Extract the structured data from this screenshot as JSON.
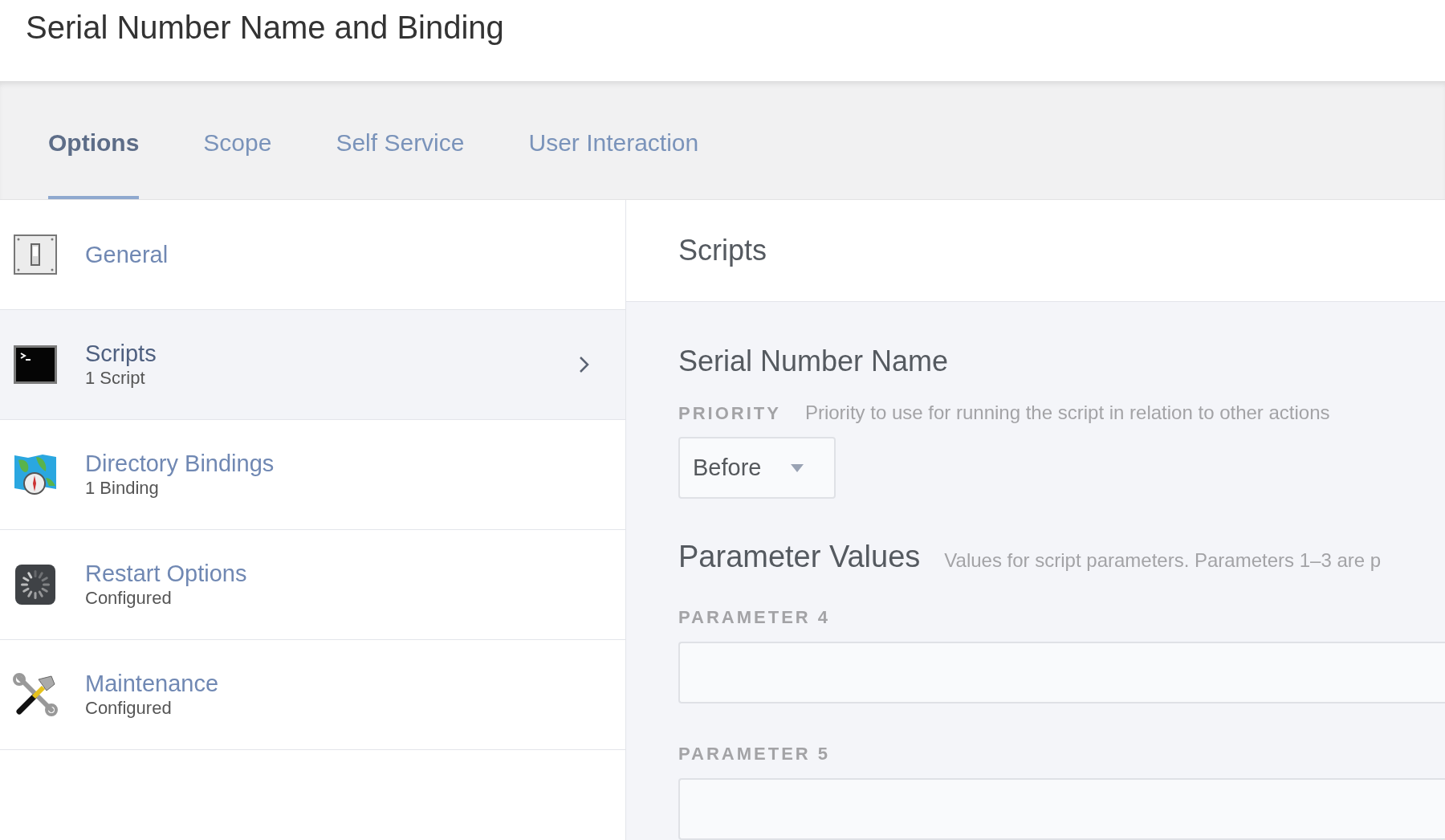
{
  "page": {
    "title": "Serial Number Name and Binding"
  },
  "tabs": [
    {
      "label": "Options",
      "selected": true
    },
    {
      "label": "Scope",
      "selected": false
    },
    {
      "label": "Self Service",
      "selected": false
    },
    {
      "label": "User Interaction",
      "selected": false
    }
  ],
  "sidebar": {
    "items": [
      {
        "kind": "switch",
        "title": "General",
        "selected": false
      },
      {
        "kind": "terminal",
        "title": "Scripts",
        "subtitle": "1 Script",
        "selected": true
      },
      {
        "kind": "map",
        "title": "Directory Bindings",
        "subtitle": "1 Binding",
        "selected": false
      },
      {
        "kind": "spinner",
        "title": "Restart Options",
        "subtitle": "Configured",
        "selected": false
      },
      {
        "kind": "tools",
        "title": "Maintenance",
        "subtitle": "Configured",
        "selected": false
      }
    ]
  },
  "panel": {
    "title": "Scripts",
    "script_name": "Serial Number Name",
    "priority": {
      "label": "PRIORITY",
      "help": "Priority to use for running the script in relation to other actions",
      "value": "Before"
    },
    "parameters": {
      "title": "Parameter Values",
      "help": "Values for script parameters. Parameters 1–3 are p",
      "fields": [
        {
          "label": "PARAMETER 4"
        },
        {
          "label": "PARAMETER 5"
        }
      ]
    }
  }
}
